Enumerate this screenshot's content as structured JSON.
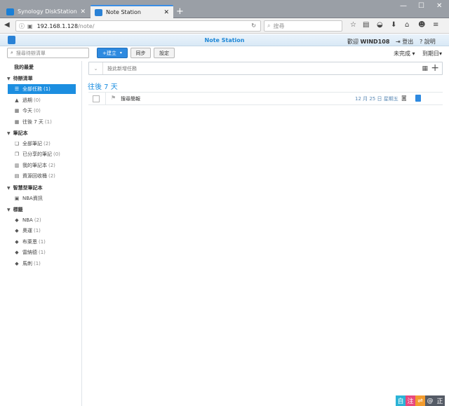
{
  "browser": {
    "tabs": [
      {
        "label": "Synology DiskStation - …",
        "active": false,
        "favicon_color": "#1a7fd6"
      },
      {
        "label": "Note Station",
        "active": true,
        "favicon_color": "#2a82d6"
      }
    ],
    "new_tab": "+",
    "window_controls": [
      "—",
      "☐",
      "✕"
    ],
    "url_domain": "192.168.1.128",
    "url_path": "/note/",
    "search_placeholder": "搜尋"
  },
  "app": {
    "title": "Note Station",
    "welcome_prefix": "歡迎",
    "username": "WIND108",
    "logout": "登出",
    "help": "說明",
    "accent_color": "#1c8ee0"
  },
  "toolbar": {
    "search_placeholder": "搜尋待辦清單",
    "create_label": "+建立",
    "sync_label": "同步",
    "settings_label": "設定",
    "status_filter": "未完成",
    "due_filter": "到期日"
  },
  "sidebar": {
    "favorites": "我的最愛",
    "sections": [
      {
        "label": "待辦清單",
        "items": [
          {
            "label": "全部任務",
            "count": "(1)",
            "icon": "list-icon",
            "selected": true
          },
          {
            "label": "過期",
            "count": "(0)",
            "icon": "warning-icon",
            "selected": false
          },
          {
            "label": "今天",
            "count": "(0)",
            "icon": "calendar-icon",
            "selected": false
          },
          {
            "label": "往後 7 天",
            "count": "(1)",
            "icon": "calendar-week-icon",
            "selected": false
          }
        ]
      },
      {
        "label": "筆記本",
        "items": [
          {
            "label": "全部筆記",
            "count": "(2)",
            "icon": "notes-icon"
          },
          {
            "label": "已分享的筆記",
            "count": "(0)",
            "icon": "shared-notes-icon"
          },
          {
            "label": "我的筆記本",
            "count": "(2)",
            "icon": "notebook-icon"
          },
          {
            "label": "資源回收桶",
            "count": "(2)",
            "icon": "trash-icon"
          }
        ]
      },
      {
        "label": "智慧型筆記本",
        "items": [
          {
            "label": "NBA資訊",
            "count": "",
            "icon": "smart-notebook-icon"
          }
        ]
      },
      {
        "label": "標籤",
        "items": [
          {
            "label": "NBA",
            "count": "(2)",
            "icon": "tag-icon"
          },
          {
            "label": "奧運",
            "count": "(1)",
            "icon": "tag-icon"
          },
          {
            "label": "布萊恩",
            "count": "(1)",
            "icon": "tag-icon"
          },
          {
            "label": "雷納德",
            "count": "(1)",
            "icon": "tag-icon"
          },
          {
            "label": "馬刺",
            "count": "(1)",
            "icon": "tag-icon"
          }
        ]
      }
    ]
  },
  "main": {
    "add_task_placeholder": "按此新增任務",
    "group_title": "往後 7 天",
    "tasks": [
      {
        "title": "搜尋簡報",
        "due": "12 月 25 日 星期五"
      }
    ]
  },
  "ime": {
    "items": [
      {
        "label": "自",
        "color": "#2cb3d6"
      },
      {
        "label": "注",
        "color": "#e8487d"
      },
      {
        "label": "⇌",
        "color": "#f29b2e"
      },
      {
        "label": "@",
        "color": "#555b66"
      },
      {
        "label": "正",
        "color": "#555b66"
      }
    ]
  }
}
